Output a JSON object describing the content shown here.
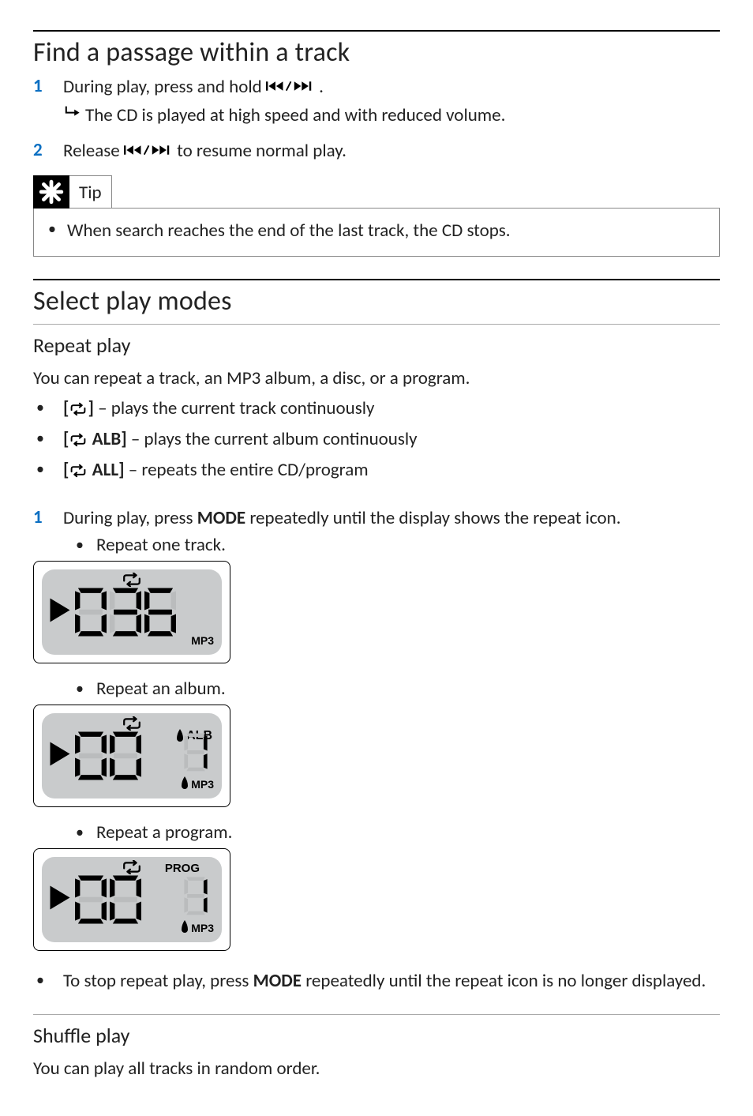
{
  "section1": {
    "title": "Find a passage within a track",
    "step1_num": "1",
    "step1_a": "During play, press and hold ",
    "step1_b": ".",
    "step1_sub": "The CD is played at high speed and with reduced volume.",
    "step2_num": "2",
    "step2_a": "Release ",
    "step2_b": " to resume normal play."
  },
  "tip": {
    "label": "Tip",
    "text": "When search reaches the end of the last track, the CD stops."
  },
  "section2": {
    "title": "Select play modes",
    "h_repeat": "Repeat play",
    "intro": "You can repeat a track, an MP3 album, a disc, or a program.",
    "b1_prefix": "[",
    "b1_suffix": "] – plays the current track continuously",
    "b2_prefix": "[",
    "b2_mid": " ALB",
    "b2_suffix": "] – plays the current album continuously",
    "b3_prefix": "[",
    "b3_mid": " ALL",
    "b3_suffix": "] – repeats the entire CD/program",
    "step1_num": "1",
    "step1_a": "During play, press ",
    "step1_mode": "MODE",
    "step1_b": " repeatedly until the display shows the repeat icon.",
    "sub_track": "Repeat one track.",
    "sub_album": "Repeat an album.",
    "sub_program": "Repeat a program.",
    "stop_a": "To stop repeat play, press ",
    "stop_mode": "MODE",
    "stop_b": " repeatedly until the repeat icon is no longer displayed.",
    "h_shuffle": "Shuffle play",
    "shuffle_intro": "You can play all tracks in random order."
  },
  "lcd": {
    "mp3": "MP3",
    "alb": "ALB",
    "prog": "PROG",
    "track_digits": "036",
    "album_digits": "00",
    "prog_digits": "00",
    "album_track": "1",
    "prog_track": "1"
  }
}
